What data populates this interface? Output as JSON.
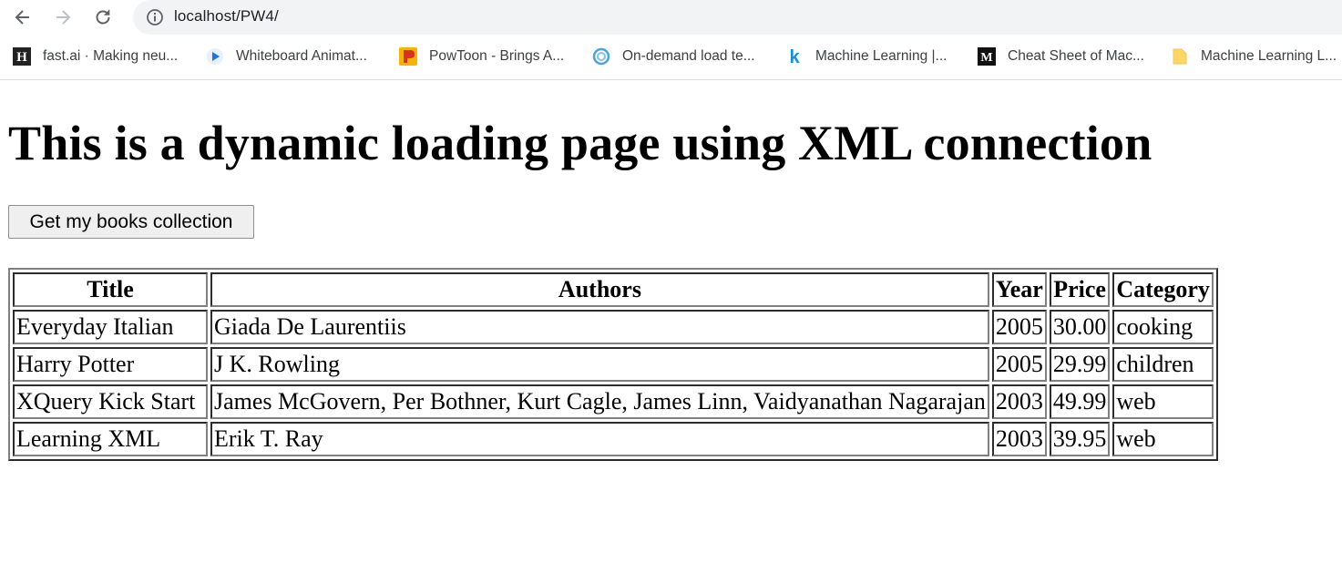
{
  "browser": {
    "url": "localhost/PW4/",
    "bookmarks": [
      {
        "label": "fast.ai · Making neu...",
        "icon": "fastai-favicon-icon"
      },
      {
        "label": "Whiteboard Animat...",
        "icon": "play-favicon-icon"
      },
      {
        "label": "PowToon - Brings A...",
        "icon": "powtoon-favicon-icon"
      },
      {
        "label": "On-demand load te...",
        "icon": "loadtest-favicon-icon"
      },
      {
        "label": "Machine Learning |...",
        "icon": "k-favicon-icon"
      },
      {
        "label": "Cheat Sheet of Mac...",
        "icon": "medium-favicon-icon"
      },
      {
        "label": "Machine Learning L...",
        "icon": "folder-icon"
      }
    ]
  },
  "page": {
    "heading": "This is a dynamic loading page using XML connection",
    "load_button_label": "Get my books collection"
  },
  "table": {
    "headers": [
      "Title",
      "Authors",
      "Year",
      "Price",
      "Category"
    ],
    "rows": [
      [
        "Everyday Italian",
        "Giada De Laurentiis",
        "2005",
        "30.00",
        "cooking"
      ],
      [
        "Harry Potter",
        "J K. Rowling",
        "2005",
        "29.99",
        "children"
      ],
      [
        "XQuery Kick Start",
        "James McGovern, Per Bothner, Kurt Cagle, James Linn, Vaidyanathan Nagarajan",
        "2003",
        "49.99",
        "web"
      ],
      [
        "Learning XML",
        "Erik T. Ray",
        "2003",
        "39.95",
        "web"
      ]
    ]
  },
  "colors": {
    "chrome_omnibox": "#f1f3f4",
    "bookmark_text": "#3c4043",
    "page_background": "#ffffff"
  }
}
